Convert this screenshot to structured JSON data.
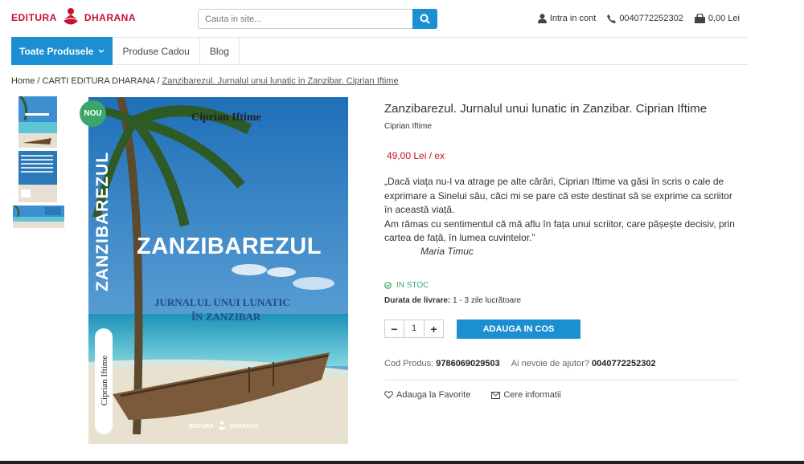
{
  "header": {
    "logo_left": "EDITURA",
    "logo_right": "DHARANA",
    "search_placeholder": "Cauta in site...",
    "account_label": "Intra in cont",
    "phone": "0040772252302",
    "cart_total": "0,00 Lei",
    "colors": {
      "accent": "#1b8fd1",
      "brand": "#c8102e",
      "stock": "#3aa66a"
    }
  },
  "nav": {
    "main_label": "Toate Produsele",
    "items": [
      "Produse Cadou",
      "Blog"
    ]
  },
  "breadcrumb": {
    "home": "Home",
    "sep": "/",
    "category": "CARTI EDITURA DHARANA",
    "current": "Zanzibarezul. Jurnalul unui lunatic in Zanzibar. Ciprian Iftime"
  },
  "cover": {
    "badge": "NOU",
    "author": "Ciprian Iftime",
    "vertical_title": "ZANZIBAREZUL",
    "title": "ZANZIBAREZUL",
    "subtitle_1": "JURNALUL UNUI LUNATIC",
    "subtitle_2": "ÎN ZANZIBAR",
    "vertical_author": "Ciprian Iftime",
    "publisher_left": "EDITURA",
    "publisher_right": "DHARANA"
  },
  "product": {
    "title": "Zanzibarezul. Jurnalul unui lunatic in Zanzibar. Ciprian Iftime",
    "author": "Ciprian Iftime",
    "price": "49,00 Lei / ex",
    "description": "„Dacă viața nu-l va atrage pe alte cărări, Ciprian Iftime va găsi în scris o cale de exprimare a Sinelui său, căci mi se pare că este destinat să se exprime ca scriitor în această viață.",
    "description_2": "Am rămas cu sentimentul că mă aflu în fața unui scriitor, care pășește decisiv, prin cartea de față, în lumea cuvintelor.”",
    "signature": "Maria Timuc",
    "stock": "IN STOC",
    "delivery_label": "Durata de livrare:",
    "delivery_value": "1 - 3 zile lucrătoare",
    "quantity": "1",
    "add_to_cart": "ADAUGA IN COS",
    "code_label": "Cod Produs:",
    "code_value": "9786069029503",
    "help_label": "Ai nevoie de ajutor?",
    "help_phone": "0040772252302",
    "favorite": "Adauga la Favorite",
    "info": "Cere informatii"
  }
}
